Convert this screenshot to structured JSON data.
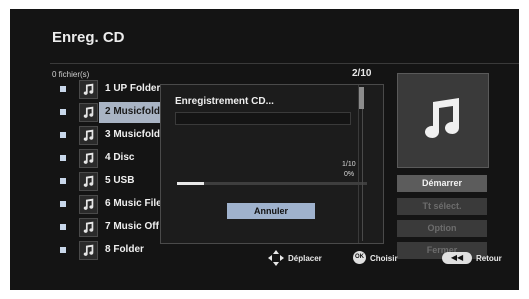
{
  "screen": {
    "title": "Enreg. CD",
    "file_count": "0 fichier(s)",
    "page": "2/10"
  },
  "tracks": [
    {
      "number": "1",
      "name": "UP Folder",
      "selected": false
    },
    {
      "number": "2",
      "name": "Musicfolde",
      "selected": true
    },
    {
      "number": "3",
      "name": "Musicfolde",
      "selected": false
    },
    {
      "number": "4",
      "name": "Disc",
      "selected": false
    },
    {
      "number": "5",
      "name": "USB",
      "selected": false
    },
    {
      "number": "6",
      "name": "Music File",
      "selected": false
    },
    {
      "number": "7",
      "name": "Music Off",
      "selected": false
    },
    {
      "number": "8",
      "name": "Folder",
      "selected": false
    }
  ],
  "dialog": {
    "title": "Enregistrement CD...",
    "progress_fraction": "1/10",
    "progress_percent": "0%",
    "progress_value": 0.14,
    "cancel_label": "Annuler"
  },
  "side_menu": {
    "start_label": "Démarrer",
    "select_all_label": "Tt sélect.",
    "option_label": "Option",
    "close_label": "Fermer"
  },
  "footer": {
    "move_label": "Déplacer",
    "choose_label": "Choisir",
    "ok_icon_text": "OK",
    "back_label": "Retour",
    "back_icon_text": "◀◀"
  },
  "icons": {
    "music": "music-note-icon",
    "nav": "dpad-arrows-icon"
  },
  "colors": {
    "selected_row": "#a9b4c4",
    "checkbox": "#c8d7ea",
    "cancel_button": "#9fb2cd",
    "background": "#141414"
  }
}
